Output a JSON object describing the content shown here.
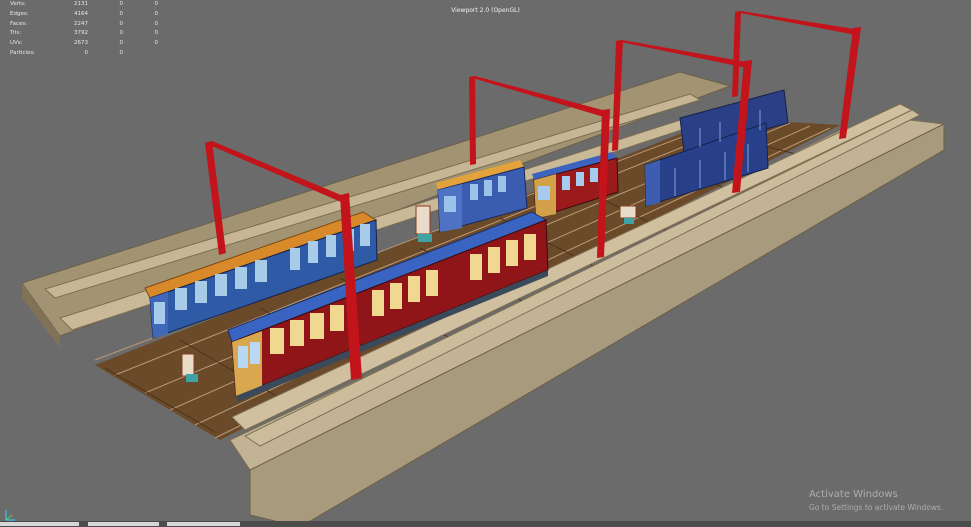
{
  "viewport": {
    "title": "Viewport 2.0 (OpenGL)"
  },
  "hud": {
    "rows": [
      {
        "label": "Verts:",
        "v1": "2131",
        "v2": "0",
        "v3": "0"
      },
      {
        "label": "Edges:",
        "v1": "4164",
        "v2": "0",
        "v3": "0"
      },
      {
        "label": "Faces:",
        "v1": "2247",
        "v2": "0",
        "v3": "0"
      },
      {
        "label": "Tris:",
        "v1": "3792",
        "v2": "0",
        "v3": "0"
      },
      {
        "label": "UVs:",
        "v1": "2673",
        "v2": "0",
        "v3": "0"
      },
      {
        "label": "Particles:",
        "v1": "0",
        "v2": "0",
        "v3": ""
      }
    ]
  },
  "watermark": {
    "title": "Activate Windows",
    "subtitle": "Go to Settings to activate Windows."
  },
  "colors": {
    "background": "#6b6b6b",
    "platform": "#a5977b",
    "gantry": "#c8141a",
    "train_red": "#a0161a",
    "train_blue": "#2d4f9a",
    "roof_orange": "#d98a2a"
  }
}
